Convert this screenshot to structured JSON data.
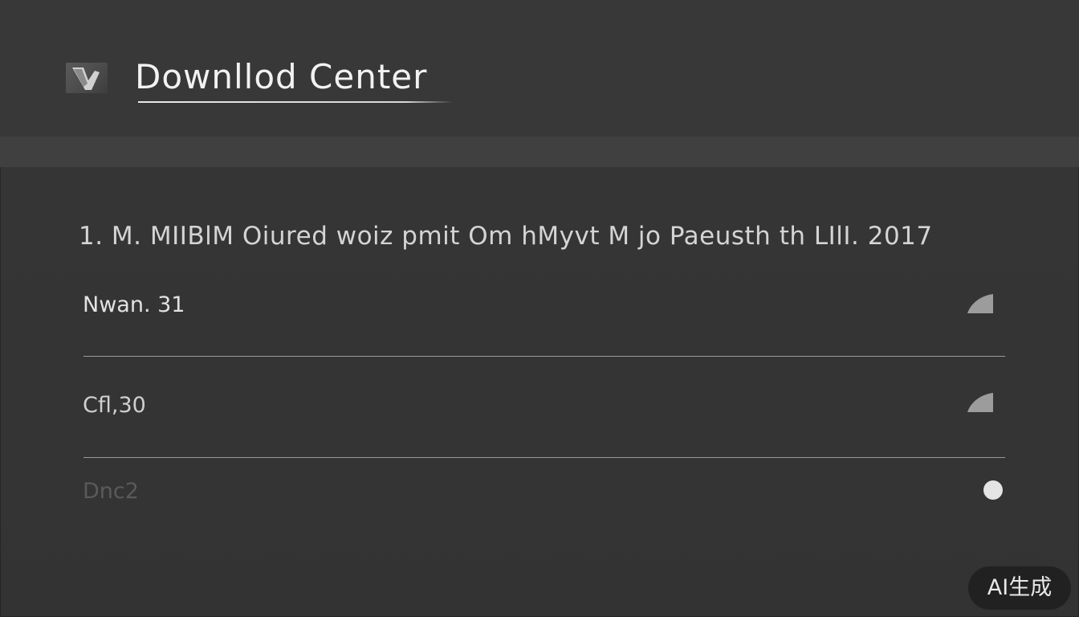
{
  "header": {
    "title": "Downllod Center",
    "app_icon": "app-logo-icon"
  },
  "main": {
    "heading": "1. M. MIIBlM  Oiured woiz pmit Om hMyvt M jo Paeusth th LIlI. 2017",
    "rows": [
      {
        "label": "Nwan. 31",
        "icon": "triangle-download-icon",
        "muted": false
      },
      {
        "label": "Cfl,30",
        "icon": "triangle-download-icon",
        "muted": false
      },
      {
        "label": "Dnc2",
        "icon": "circle-status-icon",
        "muted": true
      }
    ]
  },
  "watermark": {
    "label": "AI生成"
  },
  "colors": {
    "background": "#353535",
    "header": "#383838",
    "band": "#404040",
    "text": "#e6e6e6",
    "divider": "#9a9a9a"
  }
}
